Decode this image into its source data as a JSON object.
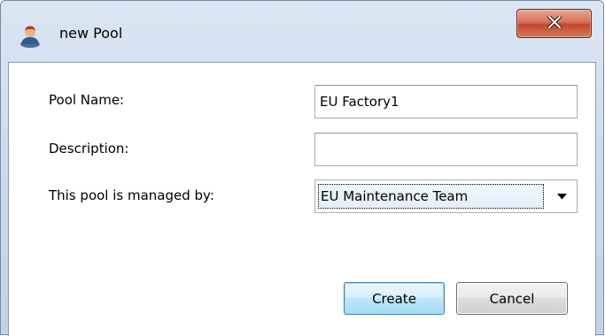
{
  "window": {
    "title": "new Pool",
    "icon": "user-icon",
    "close_icon": "close-x-icon",
    "close_color": "#c3462e"
  },
  "form": {
    "pool_name_label": "Pool Name:",
    "pool_name_value": "EU Factory1",
    "description_label": "Description:",
    "description_value": "",
    "managed_by_label": "This pool is managed by:",
    "managed_by_value": "EU Maintenance Team",
    "dropdown_icon": "chevron-down-icon"
  },
  "buttons": {
    "create_label": "Create",
    "cancel_label": "Cancel"
  }
}
